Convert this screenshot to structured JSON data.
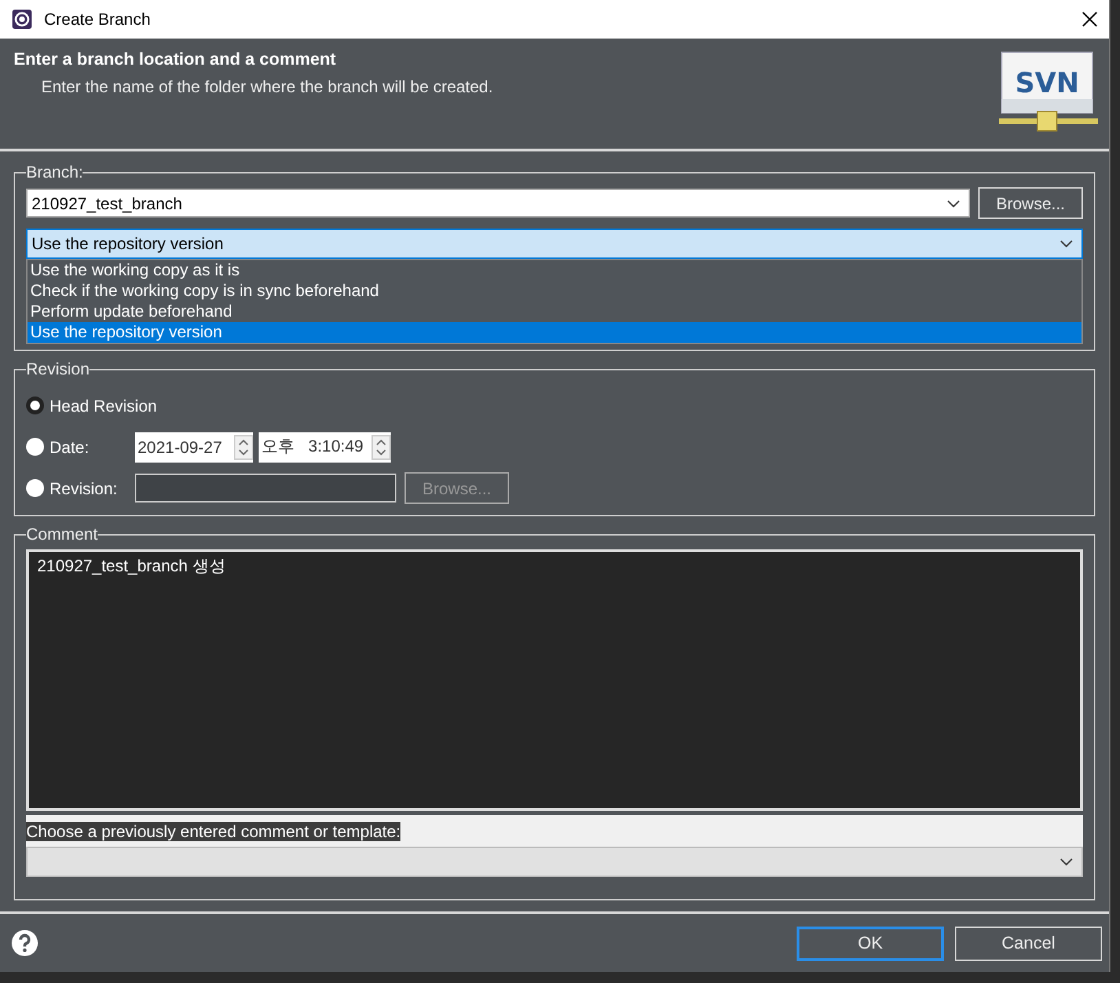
{
  "window": {
    "title": "Create Branch"
  },
  "header": {
    "title": "Enter a branch location and a comment",
    "description": "Enter the name of the folder where the branch will be created.",
    "logo": "SVN"
  },
  "branch": {
    "legend": "Branch:",
    "location": "210927_test_branch",
    "browse_button": "Browse...",
    "update_mode": {
      "value": "Use the repository version",
      "expanded": true,
      "options": [
        {
          "label": "Use the working copy as it is",
          "selected": false
        },
        {
          "label": "Check if the working copy is in sync beforehand",
          "selected": false
        },
        {
          "label": "Perform update beforehand",
          "selected": false
        },
        {
          "label": "Use the repository version",
          "selected": true
        }
      ]
    }
  },
  "revision": {
    "legend": "Revision",
    "options": [
      {
        "kind": "head",
        "label": "Head Revision",
        "selected": true
      },
      {
        "kind": "date",
        "label": "Date:",
        "date": "2021-09-27",
        "time_period": "오후",
        "time": "3:10:49",
        "selected": false
      },
      {
        "kind": "number",
        "label": "Revision:",
        "browse_button": "Browse...",
        "browse_disabled": true,
        "selected": false
      }
    ]
  },
  "comment": {
    "legend": "Comment",
    "text": "210927_test_branch 생성",
    "history_label": "Choose a previously entered comment or template:"
  },
  "buttons": [
    {
      "label": "OK",
      "default": true
    },
    {
      "label": "Cancel",
      "default": false
    }
  ]
}
